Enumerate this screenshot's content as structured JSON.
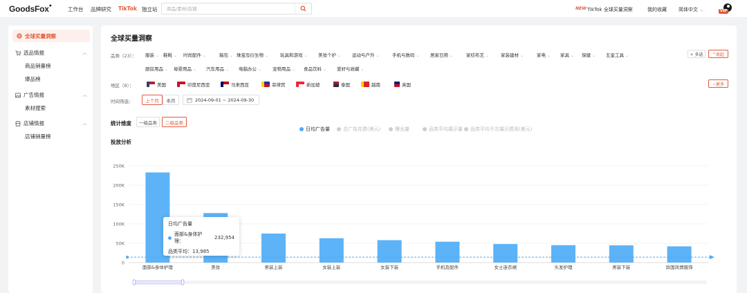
{
  "topbar": {
    "logo": "GoodsFox",
    "nav": [
      {
        "label": "工作台",
        "active": false
      },
      {
        "label": "品牌研究",
        "active": false
      },
      {
        "label": "TikTok",
        "active": true
      },
      {
        "label": "独立站",
        "active": false
      }
    ],
    "search_placeholder": "商品/素材/店铺",
    "new_tag": "NEW",
    "tiktok_link": "TikTok 全球买量洞察",
    "favorites": "我的收藏",
    "language": "简体中文",
    "vip": "VIP"
  },
  "sidebar": {
    "active": "全球买量洞察",
    "groups": [
      {
        "label": "选品情报",
        "items": [
          "商品销量榜",
          "爆品榜"
        ]
      },
      {
        "label": "广告情报",
        "items": [
          "素材搜索"
        ]
      },
      {
        "label": "店铺情报",
        "items": [
          "店铺销量榜"
        ]
      }
    ]
  },
  "main": {
    "title": "全球买量洞察",
    "category_label": "品类（23）：",
    "categories_row1": [
      "服装",
      "鞋靴",
      "时尚配件",
      "箱包",
      "珠宝及衍生物",
      "玩具和游戏",
      "美妆个护",
      "运动与户外",
      "手机与数码",
      "居家日用",
      "家纺布艺",
      "家装建材",
      "家电",
      "家具",
      "保健",
      "五金工具"
    ],
    "categories_row2": [
      "厨房用品",
      "母婴用品",
      "汽车用品",
      "电脑办公",
      "宠物用品",
      "食品饮料",
      "爱好与收藏"
    ],
    "multi_select": "+ 多选",
    "collapse": "^收起",
    "region_label": "地区（8）：",
    "regions": [
      {
        "name": "美国",
        "flag": "us"
      },
      {
        "name": "印度尼西亚",
        "flag": "id"
      },
      {
        "name": "马来西亚",
        "flag": "my"
      },
      {
        "name": "菲律宾",
        "flag": "ph"
      },
      {
        "name": "新加坡",
        "flag": "sg"
      },
      {
        "name": "泰国",
        "flag": "th"
      },
      {
        "name": "越南",
        "flag": "vn"
      },
      {
        "name": "英国",
        "flag": "gb"
      }
    ],
    "more": "更多",
    "time_label": "时间筛选：",
    "time_tabs": [
      "上个月",
      "本月"
    ],
    "date_range": "2024-09-01 ~ 2024-09-30",
    "stat_label": "统计维度",
    "stat_tabs": [
      "一级品类",
      "二级品类"
    ],
    "analysis_title": "投放分析"
  },
  "chart_data": {
    "type": "bar",
    "legend": [
      {
        "name": "日均广告量",
        "color": "#4fa8f5",
        "active": true
      },
      {
        "name": "总广告花费(美元)",
        "color": "#cccccc",
        "active": false
      },
      {
        "name": "曝光量",
        "color": "#cccccc",
        "active": false
      },
      {
        "name": "品类平均展示量",
        "color": "#cccccc",
        "active": false
      },
      {
        "name": "品类平均千次展示费用(美元)",
        "color": "#cccccc",
        "active": false
      }
    ],
    "categories": [
      "面部&身体护理",
      "美妆",
      "男装上装",
      "女装上装",
      "女装下装",
      "手机及配件",
      "女士连衣裙",
      "头发护理",
      "男装下装",
      "异国风情服饰"
    ],
    "values": [
      232954,
      128000,
      75000,
      63000,
      58000,
      54000,
      48000,
      45000,
      44500,
      42000
    ],
    "average": 13985,
    "y_ticks": [
      "250K",
      "200K",
      "150K",
      "100K",
      "50K",
      "0"
    ],
    "ylim": [
      0,
      250000
    ],
    "color": "#5cb3f7",
    "tooltip": {
      "title": "日均广告量",
      "series_line": "面部&身体护理：",
      "series_value": "232,954",
      "avg_label": "品类平均：",
      "avg_value": "13,985"
    }
  }
}
